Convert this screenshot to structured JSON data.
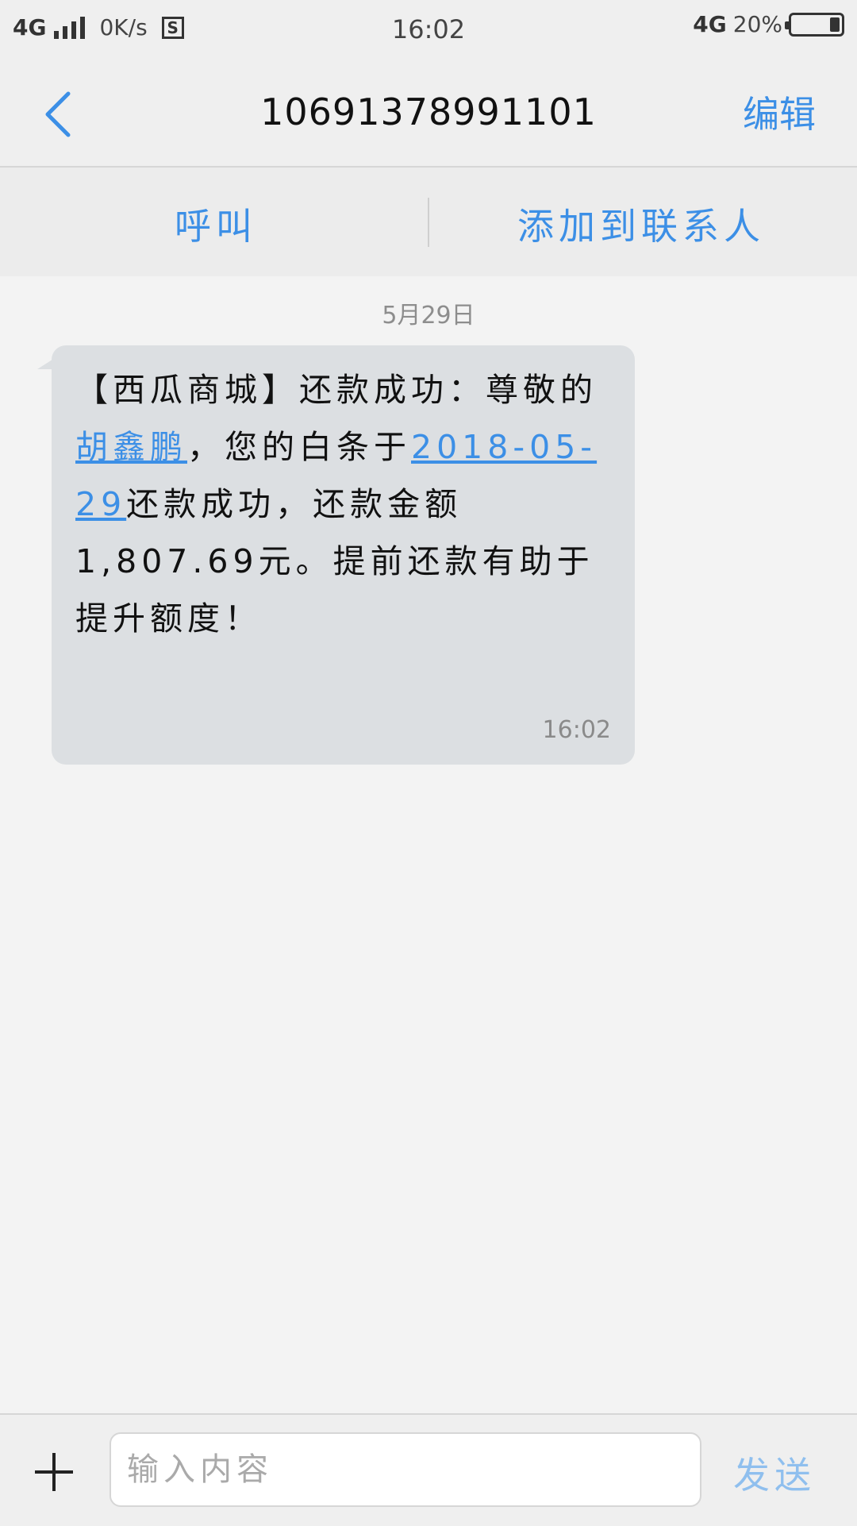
{
  "status_bar": {
    "network_left": "4G",
    "speed": "0K/s",
    "s_badge": "S",
    "time": "16:02",
    "network_right": "4G",
    "battery": "20%",
    "battery_level": 0.2
  },
  "header": {
    "title": "10691378991101",
    "edit_label": "编辑"
  },
  "actions": {
    "call_label": "呼叫",
    "add_contact_label": "添加到联系人"
  },
  "conversation": {
    "date": "5月29日",
    "message": {
      "part1": "【西瓜商城】还款成功：尊敬的",
      "name_link": "胡鑫鹏",
      "part2": "，您的白条于",
      "date_link": "2018-05-29",
      "part3": "还款成功，还款金额1,807.69元。提前还款有助于提升额度！",
      "time": "16:02"
    }
  },
  "input_bar": {
    "placeholder": "输入内容",
    "send_label": "发送"
  }
}
